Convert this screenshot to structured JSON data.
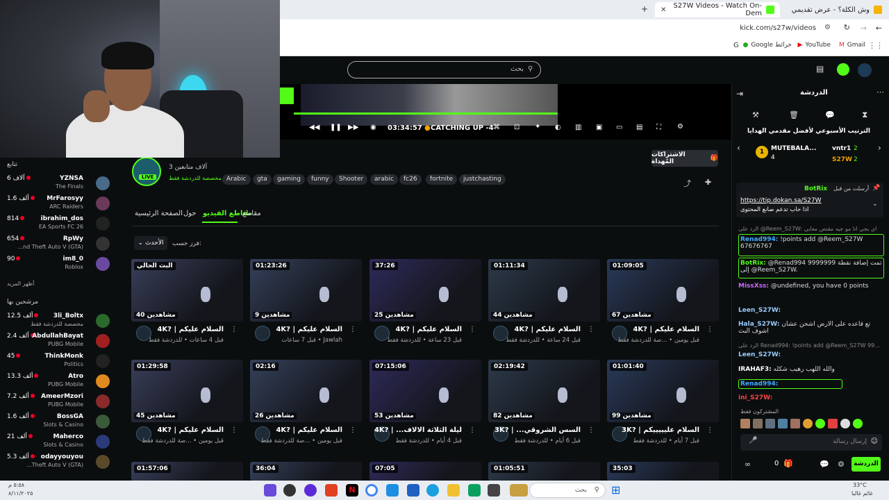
{
  "browser": {
    "tabs": [
      {
        "label": "S27W Videos - Watch On-Dem",
        "active": true
      },
      {
        "label": "وش الكلة؟ - عرض تقديمي",
        "active": false
      }
    ],
    "url": "kick.com/s27w/videos",
    "bookmarks": [
      "Gmail",
      "YouTube",
      "Google خرائط"
    ]
  },
  "kick": {
    "search_placeholder": "بحث",
    "player": {
      "time": "03:34:57",
      "status": "CATCHING UP -4"
    }
  },
  "sidebar": {
    "following_title": "تتابع",
    "show_more": "أظهر المزيد",
    "recommended_title": "مرشحين بها",
    "following": [
      {
        "name": "YZNSA",
        "game": "The Finals",
        "count": "6 آلاف"
      },
      {
        "name": "MrFarosyy",
        "game": "ARC Raiders",
        "count": "1.6 ألف"
      },
      {
        "name": "ibrahim_dos",
        "game": "EA Sports FC 26",
        "count": "814"
      },
      {
        "name": "RpWy",
        "game": "...nd Theft Auto V (GTA)",
        "count": "654"
      },
      {
        "name": "im8_0",
        "game": "Roblox",
        "count": "90"
      }
    ],
    "recommended": [
      {
        "name": "3li_Boltx",
        "game": "مخصصة للدردشة فقط",
        "count": "12.5 ألف"
      },
      {
        "name": "AbdullahBayat",
        "game": "PUBG Mobile",
        "count": "2.4 ألف"
      },
      {
        "name": "ThinkMonk",
        "game": "Politics",
        "count": "45"
      },
      {
        "name": "Atro",
        "game": "PUBG Mobile",
        "count": "13.3 ألف"
      },
      {
        "name": "AmeerMzori",
        "game": "PUBG Mobile",
        "count": "7.2 ألف"
      },
      {
        "name": "BossGA",
        "game": "Slots & Casino",
        "count": "1.6 ألف"
      },
      {
        "name": "Maherco",
        "game": "Slots & Casino",
        "count": "21 ألف"
      },
      {
        "name": "odayyouyou",
        "game": "...Theft Auto V (GTA)",
        "count": "5.3 ألف"
      }
    ]
  },
  "channel": {
    "name": "S27W",
    "followers": "3 آلاف متابعين",
    "category": "مخصصة للدردشة فقط",
    "live_badge": "LIVE",
    "gift_button": "الاشتراكات المُهداة",
    "tags": [
      "Arabic",
      "gta",
      "gaming",
      "funny",
      "Shooter",
      "arabic",
      "fc26",
      "fortnite",
      "justchasting"
    ],
    "nav": [
      "الصفحة الرئيسية",
      "حول",
      "مقاطع الفيديو",
      "مقاطع"
    ],
    "sort_label": "فرز حسب:",
    "sort_value": "الأحدث"
  },
  "videos": [
    {
      "duration": "البث الحالي",
      "views": "40 مشاهدين",
      "title": "4K? | السلام عليكم",
      "meta": "قبل 4 ساعات • للدردشة فقط"
    },
    {
      "duration": "01:23:26",
      "views": "9 مشاهدين",
      "title": "4K? | السلام عليكم",
      "meta": "قبل 7 ساعات • Jawlah"
    },
    {
      "duration": "37:26",
      "views": "25 مشاهدين",
      "title": "4K? | السلام عليكم",
      "meta": "قبل 23 ساعة • للدردشة فقط"
    },
    {
      "duration": "01:11:34",
      "views": "44 مشاهدين",
      "title": "4K? | السلام عليكم",
      "meta": "قبل 24 ساعة • للدردشة فقط"
    },
    {
      "duration": "01:09:05",
      "views": "67 مشاهدين",
      "title": "4K? | السلام عليكم",
      "meta": "قبل يومين • ...صة للدردشة فقط"
    },
    {
      "duration": "01:29:58",
      "views": "45 مشاهدين",
      "title": "4K? | السلام عليكم",
      "meta": "قبل يومين • ...صة للدردشة فقط"
    },
    {
      "duration": "02:16",
      "views": "26 مشاهدين",
      "title": "4K? | السلام عليكم",
      "meta": "قبل يومين • ...صة للدردشة فقط"
    },
    {
      "duration": "07:15:06",
      "views": "53 مشاهدين",
      "title": "4K? | ...ليلة الثلاثة الالاف",
      "meta": "قبل 4 أيام • للدردشة فقط"
    },
    {
      "duration": "02:19:42",
      "views": "82 مشاهدين",
      "title": "3K? | ...السس الشروقي",
      "meta": "قبل 6 أيام • للدردشة فقط"
    },
    {
      "duration": "01:01:40",
      "views": "99 مشاهدين",
      "title": "3K? | السلام عليييييكم",
      "meta": "قبل 7 أيام • للدردشة فقط"
    },
    {
      "duration": "01:57:06",
      "views": "",
      "title": "",
      "meta": ""
    },
    {
      "duration": "36:04",
      "views": "",
      "title": "",
      "meta": ""
    },
    {
      "duration": "07:05",
      "views": "",
      "title": "",
      "meta": ""
    },
    {
      "duration": "01:05:51",
      "views": "",
      "title": "",
      "meta": ""
    },
    {
      "duration": "35:03",
      "views": "",
      "title": "",
      "meta": ""
    }
  ],
  "chat": {
    "title": "الدردشة",
    "leaderboard_title": "الترتيب الأسبوعي لأفضل مقدمي الهدايا",
    "leaders": [
      {
        "name": "MUTEBALA...",
        "count": "4"
      },
      {
        "name": "vntr1",
        "count": "2"
      },
      {
        "name": "S27W",
        "count": "2"
      }
    ],
    "pinned_by": "أرسلت من قبل",
    "pinned_user": "BotRix",
    "pinned_link": "https://tip.dokan.sa/S27W",
    "pinned_text": "اذا حاب تدعم صانع المحتوى",
    "messages": [
      {
        "user": "",
        "text": "الرد على @Reem_S27W: اي يجي انا مو جيه مقنص معايي"
      },
      {
        "user": "Renad994:",
        "text": "!points add @Reem_S27W 67676767"
      },
      {
        "user": "BotRix:",
        "text": "@Renad994 9999999 تمت إضافة نقطة إلى @Reem_S27W."
      },
      {
        "user": "MissXss:",
        "text": "@undefined, you have 0 points"
      },
      {
        "user": "Leen_S27W:",
        "text": ""
      },
      {
        "user": "Hala_S27W:",
        "text": "تع قاعده على الارض اشحن عشان اشوف البث"
      },
      {
        "user": "",
        "text": "الرد على Renad994: !points add @Reem_S27W 99..."
      },
      {
        "user": "Leen_S27W:",
        "text": ""
      },
      {
        "user": "IRAHAF3:",
        "text": "والله اللهب رهيب شكله"
      },
      {
        "user": "Renad994:",
        "text": ""
      },
      {
        "user": "ini_S27W:",
        "text": ""
      }
    ],
    "emotes_label": "المشتركون فقط",
    "input_placeholder": "إرسال رسالة",
    "points": "0",
    "send_button": "الدردشة"
  },
  "taskbar": {
    "search_placeholder": "بحث",
    "weather_temp": "33°C",
    "weather_desc": "غائم غالبا",
    "time": "٥:٥٨ م",
    "date": "٨/١١/٢٠٢٥"
  }
}
